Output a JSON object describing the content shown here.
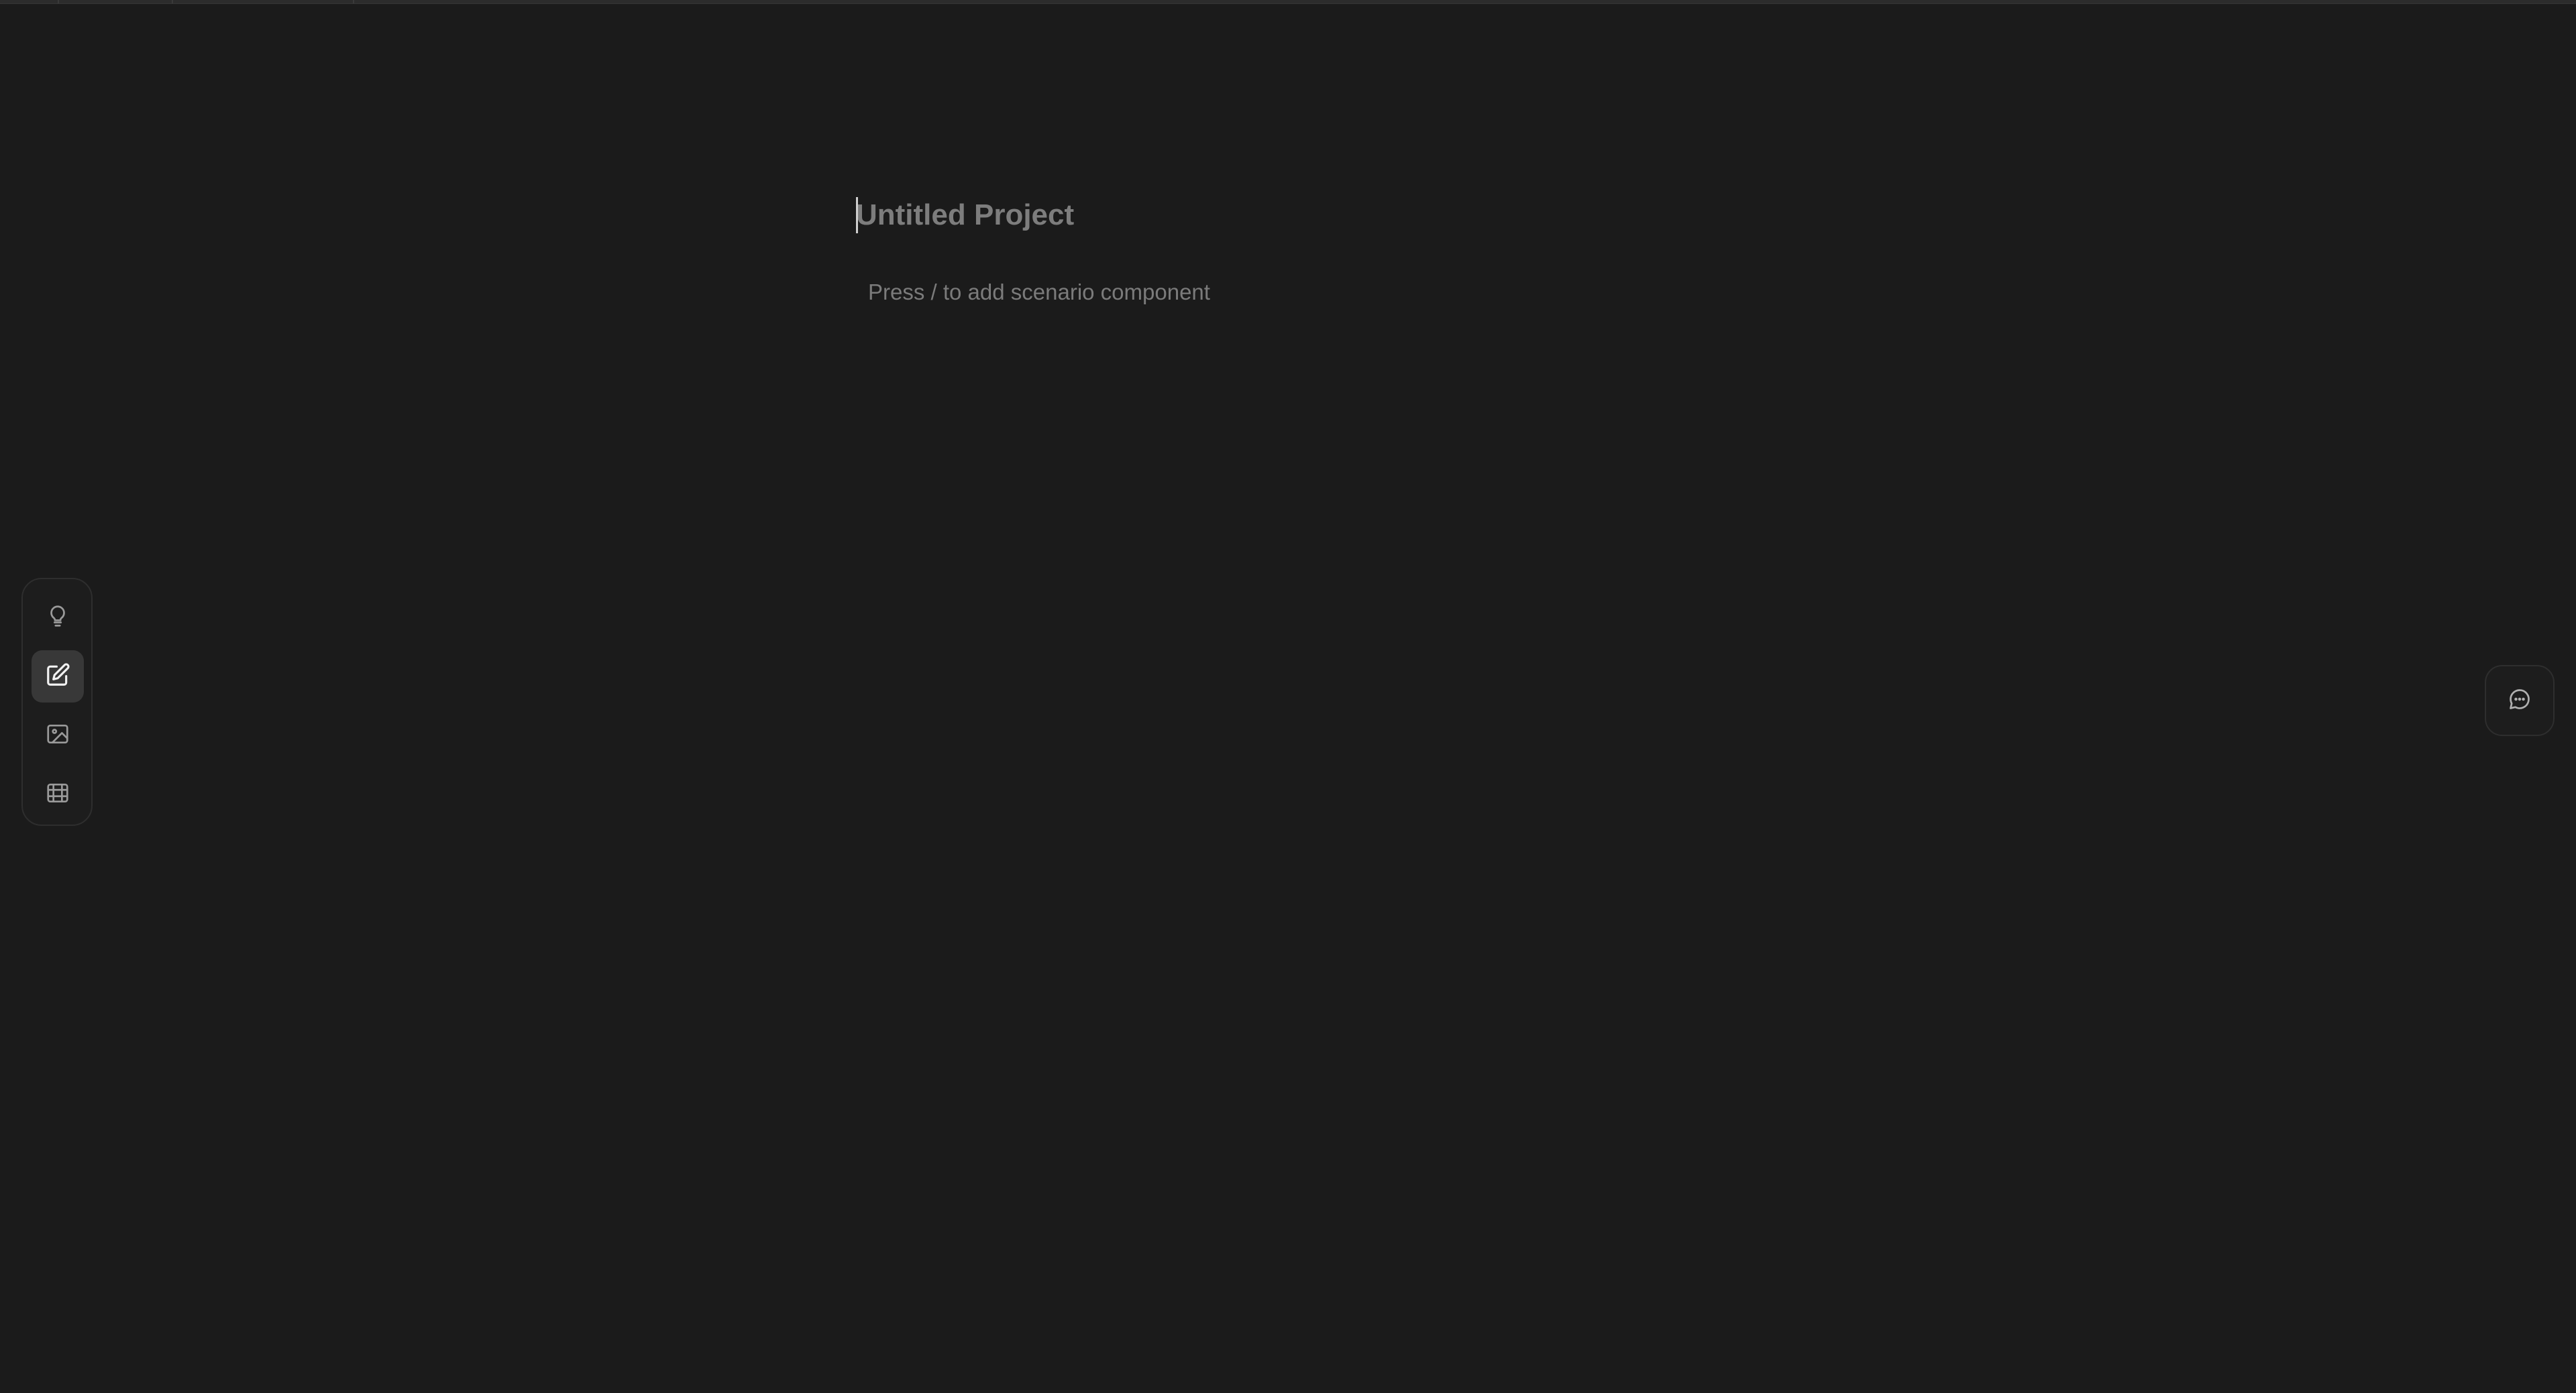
{
  "editor": {
    "title_placeholder": "Untitled Project",
    "hint": "Press / to add scenario component"
  },
  "toolbar": {
    "items": [
      {
        "name": "ideas",
        "icon": "lightbulb-icon",
        "active": false
      },
      {
        "name": "write",
        "icon": "edit-icon",
        "active": true
      },
      {
        "name": "images",
        "icon": "image-icon",
        "active": false
      },
      {
        "name": "storyboard",
        "icon": "film-icon",
        "active": false
      }
    ]
  },
  "chat": {
    "icon": "chat-bubble-icon"
  },
  "colors": {
    "background": "#1b1b1b",
    "border": "#2e2e2e",
    "active_tool": "#383838",
    "icon": "#9a9a9a",
    "placeholder": "#7d7d7d"
  }
}
